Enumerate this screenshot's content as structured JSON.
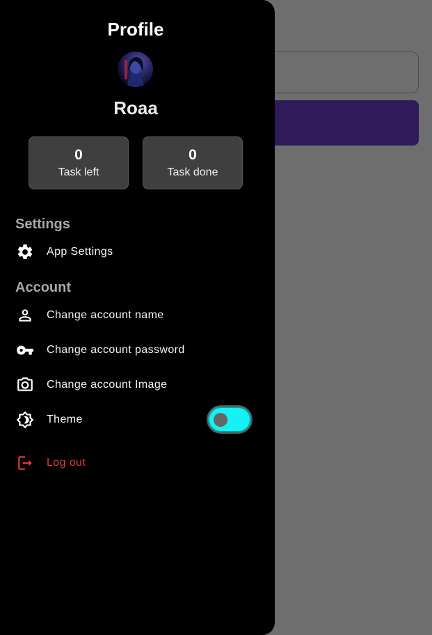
{
  "drawer": {
    "title": "Profile",
    "user_name": "Roaa",
    "stats": [
      {
        "value": "0",
        "label": "Task left"
      },
      {
        "value": "0",
        "label": "Task done"
      }
    ],
    "sections": {
      "settings": {
        "title": "Settings",
        "items": [
          {
            "label": "App Settings",
            "icon": "gear-icon"
          }
        ]
      },
      "account": {
        "title": "Account",
        "items": [
          {
            "label": "Change account name",
            "icon": "person-icon"
          },
          {
            "label": "Change account password",
            "icon": "key-icon"
          },
          {
            "label": "Change account Image",
            "icon": "camera-icon"
          },
          {
            "label": "Theme",
            "icon": "brightness-icon"
          }
        ]
      }
    },
    "theme_toggle": {
      "state": "off"
    },
    "logout": {
      "label": "Log out",
      "icon": "logout-icon"
    }
  },
  "colors": {
    "drawer_bg": "#000000",
    "scrim": "#6e6e6e",
    "toggle_track": "#16f2f4",
    "logout": "#e53935",
    "section_title": "#a8a8a8",
    "card_bg": "#3f3f3f",
    "primary_button": "#2f1a5a"
  }
}
